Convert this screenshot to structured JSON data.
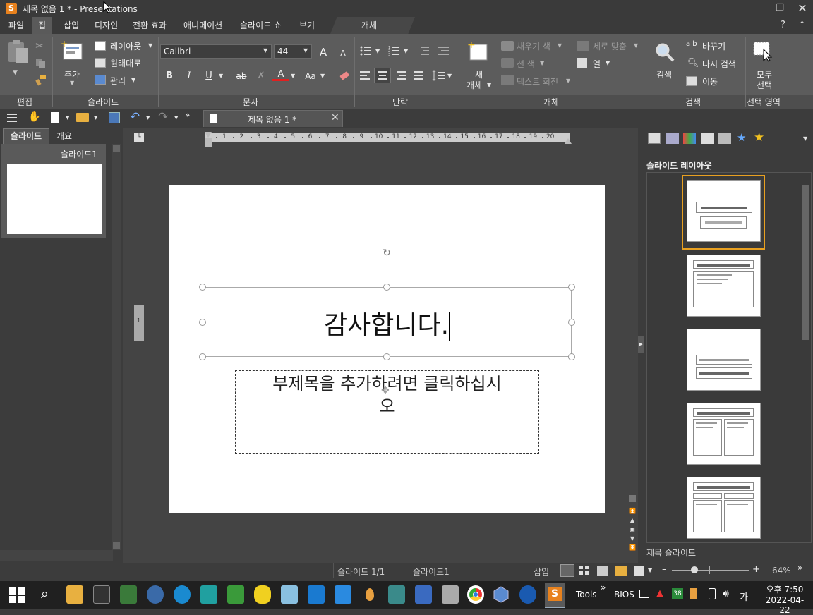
{
  "window": {
    "title": "제목 없음 1 * - Presentations",
    "app_letter": "S"
  },
  "menu": {
    "tabs": [
      "파일",
      "집",
      "삽입",
      "디자인",
      "전환 효과",
      "애니메이션",
      "슬라이드 쇼",
      "보기"
    ],
    "context_tab": "개체",
    "help": "?"
  },
  "ribbon": {
    "groups": {
      "edit": "편집",
      "slide": "슬라이드",
      "text": "문자",
      "paragraph": "단락",
      "object": "개체",
      "search": "검색",
      "selection": "선택 영역"
    },
    "slide": {
      "add": "추가",
      "layout": "레이아웃",
      "reset": "원래대로",
      "manage": "관리"
    },
    "font": {
      "name": "Calibri",
      "size": "44"
    },
    "object": {
      "new_object_line1": "새",
      "new_object_line2": "개체",
      "fill_color": "채우기 색",
      "line_color": "선 색",
      "text_rotate": "텍스트 회전",
      "vertical_align": "세로 맞춤",
      "columns": "열"
    },
    "search": {
      "search": "검색",
      "replace": "바꾸기",
      "replace_prefix": "a b",
      "search_again": "다시 검색",
      "goto": "이동"
    },
    "selection": {
      "select_all_line1": "모두",
      "select_all_line2": "선택"
    }
  },
  "document_tab": {
    "name": "제목 없음 1 *"
  },
  "left_panel": {
    "tabs": [
      "슬라이드",
      "개요"
    ],
    "slide_label": "슬라이드1"
  },
  "ruler": {
    "ticks": [
      "1",
      "2",
      "3",
      "4",
      "5",
      "6",
      "7",
      "8",
      "9",
      "10",
      "11",
      "12",
      "13",
      "14",
      "15",
      "16",
      "17",
      "18",
      "19",
      "20"
    ]
  },
  "slide": {
    "title": "감사합니다.",
    "subtitle_placeholder_line1": "부제목을 추가하려면 클릭하십시",
    "subtitle_placeholder_line2": "오",
    "page_marker": "1"
  },
  "right_panel": {
    "title": "슬라이드 레이아웃",
    "footer": "제목 슬라이드"
  },
  "status": {
    "slide_count": "슬라이드 1/1",
    "slide_name": "슬라이드1",
    "mode": "삽입",
    "zoom": "64%"
  },
  "taskbar": {
    "tools": "Tools",
    "bios": "BIOS",
    "time_line1": "오후 7:50",
    "time_line2": "2022-04-22",
    "ime": "가",
    "badge": "38"
  },
  "colors": {
    "accent_orange": "#e8a020",
    "app_logo": "#e8821e"
  }
}
